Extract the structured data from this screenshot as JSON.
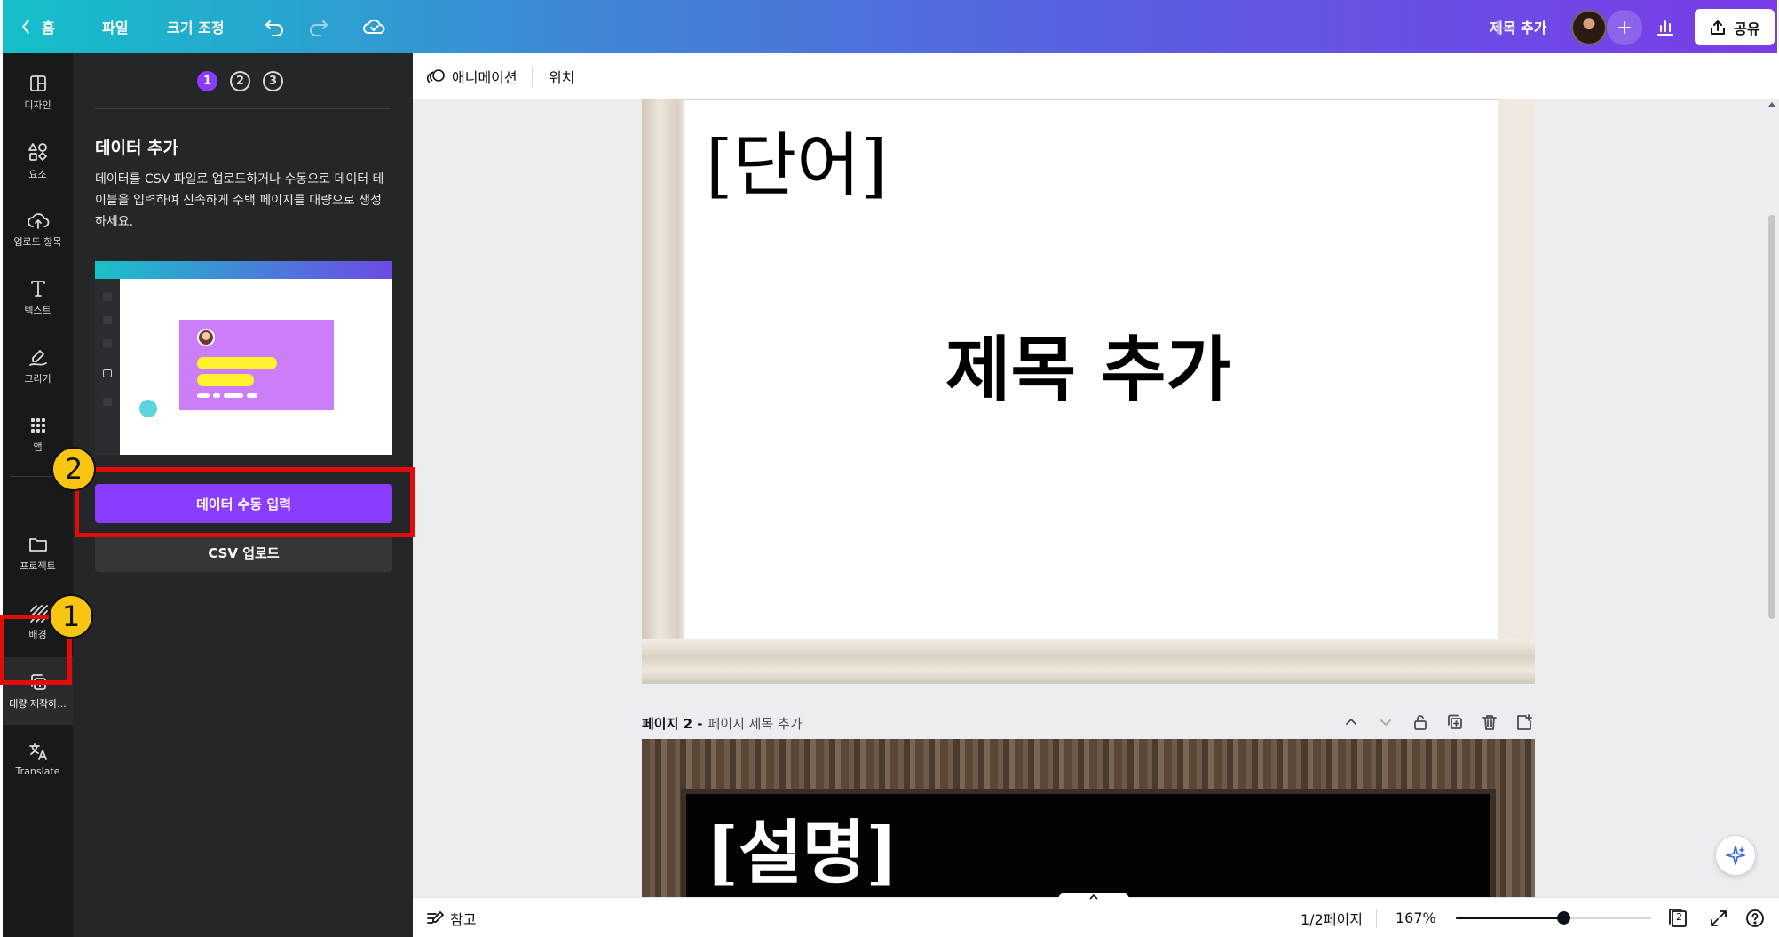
{
  "topbar": {
    "home_label": "홈",
    "file_label": "파일",
    "resize_label": "크기 조정",
    "doc_title": "제목 추가",
    "share_label": "공유",
    "gradient_colors": [
      "#13c0c9",
      "#7a3ce8"
    ]
  },
  "rail": {
    "items": [
      {
        "label": "디자인",
        "icon": "layout-icon"
      },
      {
        "label": "요소",
        "icon": "shapes-icon"
      },
      {
        "label": "업로드 항목",
        "icon": "cloud-upload-icon"
      },
      {
        "label": "텍스트",
        "icon": "text-icon"
      },
      {
        "label": "그리기",
        "icon": "draw-icon"
      },
      {
        "label": "앱",
        "icon": "apps-grid-icon"
      },
      {
        "label": "프로젝트",
        "icon": "folder-icon"
      },
      {
        "label": "배경",
        "icon": "background-icon"
      },
      {
        "label": "대량 제작하...",
        "icon": "bulk-create-icon"
      },
      {
        "label": "Translate",
        "icon": "translate-icon"
      }
    ]
  },
  "panel": {
    "steps": [
      "1",
      "2",
      "3"
    ],
    "current_step": "1",
    "title": "데이터 추가",
    "description": "데이터를 CSV 파일로 업로드하거나 수동으로 데이터 테이블을 입력하여 신속하게 수백 페이지를 대량으로 생성하세요.",
    "primary_button": "데이터 수동 입력",
    "secondary_button": "CSV 업로드",
    "accent_color": "#8b3dff"
  },
  "annotations": {
    "badge_1": "1",
    "badge_2": "2",
    "highlight_color": "#e40b0b"
  },
  "context_bar": {
    "animate_label": "애니메이션",
    "position_label": "위치"
  },
  "canvas": {
    "page1": {
      "label_text": "[단어]",
      "title_text": "제목 추가"
    },
    "page2": {
      "page_label": "페이지 2 -",
      "page_title_placeholder": "페이지 제목 추가",
      "label_text": "[설명]"
    }
  },
  "bottombar": {
    "notes_label": "참고",
    "page_indicator": "1/2페이지",
    "zoom": "167%",
    "zoom_slider_fraction": 0.55,
    "pages_count": "2"
  }
}
